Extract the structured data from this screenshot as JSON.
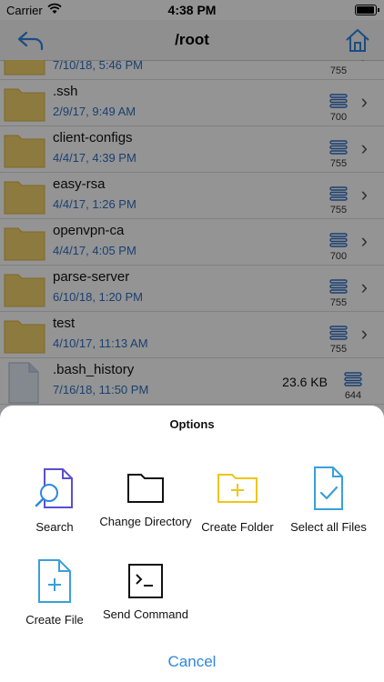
{
  "status_bar": {
    "carrier": "Carrier",
    "time": "4:38 PM"
  },
  "nav": {
    "title": "/root",
    "back_icon": "back-arrow-icon",
    "home_icon": "home-icon"
  },
  "files": [
    {
      "name": "",
      "date": "7/10/18, 5:46 PM",
      "perm": "755",
      "type": "folder"
    },
    {
      "name": ".ssh",
      "date": "2/9/17, 9:49 AM",
      "perm": "700",
      "type": "folder"
    },
    {
      "name": "client-configs",
      "date": "4/4/17, 4:39 PM",
      "perm": "755",
      "type": "folder"
    },
    {
      "name": "easy-rsa",
      "date": "4/4/17, 1:26 PM",
      "perm": "755",
      "type": "folder"
    },
    {
      "name": "openvpn-ca",
      "date": "4/4/17, 4:05 PM",
      "perm": "700",
      "type": "folder"
    },
    {
      "name": "parse-server",
      "date": "6/10/18, 1:20 PM",
      "perm": "755",
      "type": "folder"
    },
    {
      "name": "test",
      "date": "4/10/17, 11:13 AM",
      "perm": "755",
      "type": "folder"
    },
    {
      "name": ".bash_history",
      "date": "7/16/18, 11:50 PM",
      "perm": "644",
      "size": "23.6 KB",
      "type": "file"
    }
  ],
  "sheet": {
    "title": "Options",
    "options": [
      {
        "label": "Search",
        "icon": "search-file-icon"
      },
      {
        "label": "Change Directory",
        "icon": "folder-icon"
      },
      {
        "label": "Create Folder",
        "icon": "create-folder-icon"
      },
      {
        "label": "Select all Files",
        "icon": "select-files-icon"
      },
      {
        "label": "Create File",
        "icon": "create-file-icon"
      },
      {
        "label": "Send Command",
        "icon": "terminal-icon"
      }
    ],
    "cancel": "Cancel"
  },
  "colors": {
    "accent": "#2f86e0",
    "date": "#2e6fc2",
    "folder": "#f3d26b",
    "create_folder": "#f0c419",
    "file_icon": "#3aa0d8"
  }
}
